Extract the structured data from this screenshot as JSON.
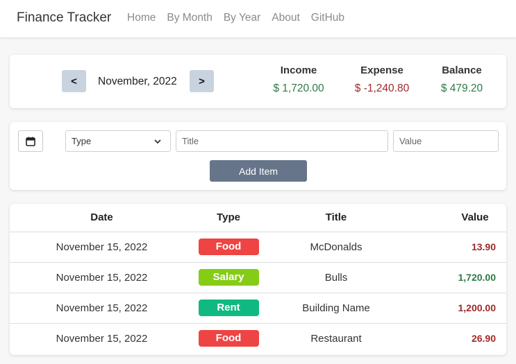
{
  "navbar": {
    "brand": "Finance Tracker",
    "links": [
      "Home",
      "By Month",
      "By Year",
      "About",
      "GitHub"
    ]
  },
  "month": {
    "prev_label": "<",
    "next_label": ">",
    "label": "November, 2022"
  },
  "summary": {
    "income_label": "Income",
    "income_value": "$ 1,720.00",
    "expense_label": "Expense",
    "expense_value": "$ -1,240.80",
    "balance_label": "Balance",
    "balance_value": "$ 479.20"
  },
  "form": {
    "calendar_icon": "calendar-icon",
    "type_selected": "Type",
    "title_placeholder": "Title",
    "value_placeholder": "Value",
    "add_label": "Add Item"
  },
  "table": {
    "headers": [
      "Date",
      "Type",
      "Title",
      "Value"
    ],
    "rows": [
      {
        "date": "November 15, 2022",
        "type": "Food",
        "title": "McDonalds",
        "value": "13.90"
      },
      {
        "date": "November 15, 2022",
        "type": "Salary",
        "title": "Bulls",
        "value": "1,720.00"
      },
      {
        "date": "November 15, 2022",
        "type": "Rent",
        "title": "Building Name",
        "value": "1,200.00"
      },
      {
        "date": "November 15, 2022",
        "type": "Food",
        "title": "Restaurant",
        "value": "26.90"
      }
    ]
  },
  "colors": {
    "income": "#2f7a45",
    "expense": "#9e2a2a",
    "food": "#ef4444",
    "salary": "#84cc16",
    "rent": "#10b981",
    "button": "#66758a",
    "arrow_button": "#c8d3df"
  }
}
